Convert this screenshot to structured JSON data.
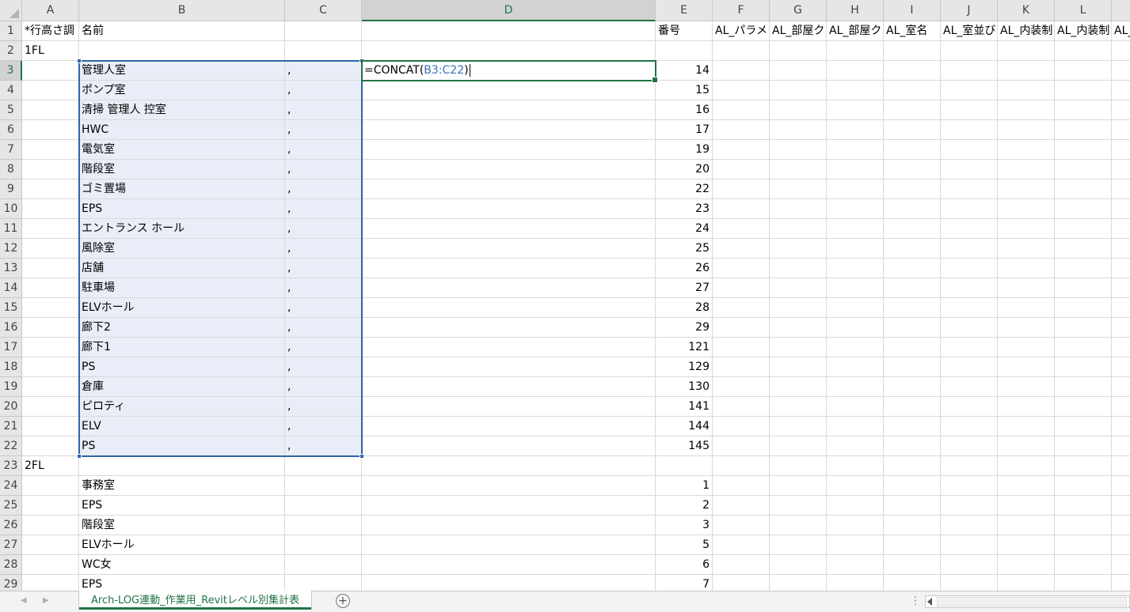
{
  "sheet": {
    "column_headers": [
      "A",
      "B",
      "C",
      "D",
      "E",
      "F",
      "G",
      "H",
      "I",
      "J",
      "K",
      "L"
    ],
    "active_column": "D",
    "active_row": 3,
    "formula": {
      "prefix": "=CONCAT(",
      "ref": "B3:C22",
      "suffix": ")"
    },
    "header_row": {
      "A": "*行高さ調",
      "B": "名前",
      "E": "番号",
      "F": "AL_パラメ",
      "G": "AL_部屋ク",
      "H": "AL_部屋ク",
      "I": "AL_室名",
      "J": "AL_室並び",
      "K": "AL_内装制",
      "L": "AL_内装制",
      "M": "AL_"
    },
    "rows": [
      {
        "n": "2",
        "a": "1FL",
        "b": "",
        "c": "",
        "e": ""
      },
      {
        "n": "3",
        "a": "",
        "b": "管理人室",
        "c": ",",
        "e": "14"
      },
      {
        "n": "4",
        "a": "",
        "b": "ポンプ室",
        "c": ",",
        "e": "15"
      },
      {
        "n": "5",
        "a": "",
        "b": "清掃 管理人 控室",
        "c": ",",
        "e": "16"
      },
      {
        "n": "6",
        "a": "",
        "b": "HWC",
        "c": ",",
        "e": "17"
      },
      {
        "n": "7",
        "a": "",
        "b": "電気室",
        "c": ",",
        "e": "19"
      },
      {
        "n": "8",
        "a": "",
        "b": "階段室",
        "c": ",",
        "e": "20"
      },
      {
        "n": "9",
        "a": "",
        "b": "ゴミ置場",
        "c": ",",
        "e": "22"
      },
      {
        "n": "10",
        "a": "",
        "b": "EPS",
        "c": ",",
        "e": "23"
      },
      {
        "n": "11",
        "a": "",
        "b": "エントランス ホール",
        "c": ",",
        "e": "24"
      },
      {
        "n": "12",
        "a": "",
        "b": "風除室",
        "c": ",",
        "e": "25"
      },
      {
        "n": "13",
        "a": "",
        "b": "店舗",
        "c": ",",
        "e": "26"
      },
      {
        "n": "14",
        "a": "",
        "b": "駐車場",
        "c": ",",
        "e": "27"
      },
      {
        "n": "15",
        "a": "",
        "b": "ELVホール",
        "c": ",",
        "e": "28"
      },
      {
        "n": "16",
        "a": "",
        "b": "廊下2",
        "c": ",",
        "e": "29"
      },
      {
        "n": "17",
        "a": "",
        "b": "廊下1",
        "c": ",",
        "e": "121"
      },
      {
        "n": "18",
        "a": "",
        "b": "PS",
        "c": ",",
        "e": "129"
      },
      {
        "n": "19",
        "a": "",
        "b": "倉庫",
        "c": ",",
        "e": "130"
      },
      {
        "n": "20",
        "a": "",
        "b": "ピロティ",
        "c": ",",
        "e": "141"
      },
      {
        "n": "21",
        "a": "",
        "b": "ELV",
        "c": ",",
        "e": "144"
      },
      {
        "n": "22",
        "a": "",
        "b": "PS",
        "c": ",",
        "e": "145"
      },
      {
        "n": "23",
        "a": "2FL",
        "b": "",
        "c": "",
        "e": ""
      },
      {
        "n": "24",
        "a": "",
        "b": "事務室",
        "c": "",
        "e": "1"
      },
      {
        "n": "25",
        "a": "",
        "b": "EPS",
        "c": "",
        "e": "2"
      },
      {
        "n": "26",
        "a": "",
        "b": "階段室",
        "c": "",
        "e": "3"
      },
      {
        "n": "27",
        "a": "",
        "b": "ELVホール",
        "c": "",
        "e": "5"
      },
      {
        "n": "28",
        "a": "",
        "b": "WC女",
        "c": "",
        "e": "6"
      },
      {
        "n": "29",
        "a": "",
        "b": "EPS",
        "c": "",
        "e": "7"
      }
    ]
  },
  "tabs": {
    "active_sheet": "Arch-LOG連動_作業用_Revitレベル別集計表"
  },
  "icons": [
    "select-all-triangle-icon",
    "prev-sheet-icon",
    "next-sheet-icon",
    "add-sheet-icon",
    "scroll-left-icon"
  ],
  "colors": {
    "accent_green": "#217346",
    "range_blue": "#2e64a8",
    "range_fill": "#e8edf7"
  }
}
